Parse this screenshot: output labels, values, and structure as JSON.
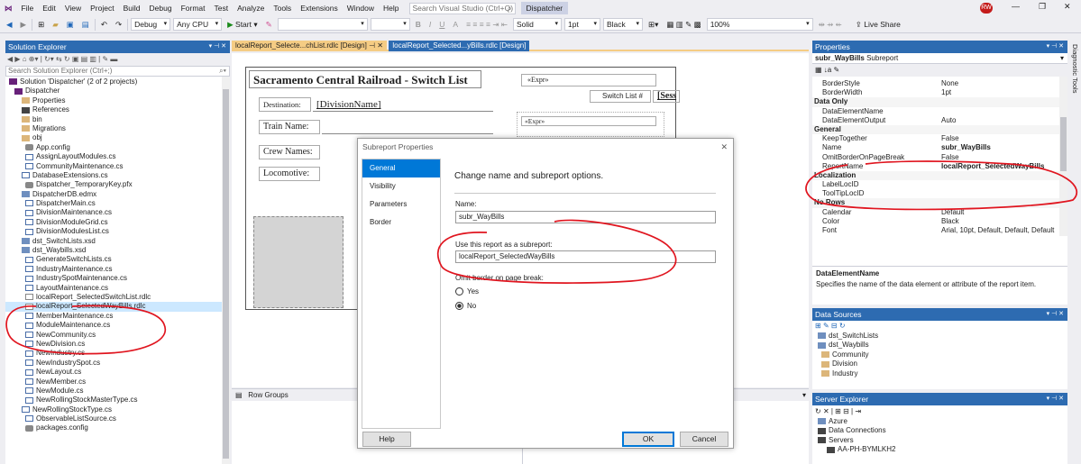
{
  "menu": {
    "items": [
      "File",
      "Edit",
      "View",
      "Project",
      "Build",
      "Debug",
      "Format",
      "Test",
      "Analyze",
      "Tools",
      "Extensions",
      "Window",
      "Help"
    ],
    "search_placeholder": "Search Visual Studio (Ctrl+Q)",
    "solution_name": "Dispatcher",
    "avatar": "RW",
    "live_share": "Live Share"
  },
  "toolbar": {
    "config": "Debug",
    "platform": "Any CPU",
    "start": "Start",
    "border_style": "Solid",
    "border_width": "1pt",
    "border_color": "Black",
    "zoom": "100%"
  },
  "solution_explorer": {
    "title": "Solution Explorer",
    "search_placeholder": "Search Solution Explorer (Ctrl+;)",
    "items": [
      "Solution 'Dispatcher' (2 of 2 projects)",
      "Dispatcher",
      "Properties",
      "References",
      "bin",
      "Migrations",
      "obj",
      "App.config",
      "AssignLayoutModules.cs",
      "CommunityMaintenance.cs",
      "DatabaseExtensions.cs",
      "Dispatcher_TemporaryKey.pfx",
      "DispatcherDB.edmx",
      "DispatcherMain.cs",
      "DivisionMaintenance.cs",
      "DivisionModuleGrid.cs",
      "DivisionModulesList.cs",
      "dst_SwitchLists.xsd",
      "dst_Waybills.xsd",
      "GenerateSwitchLists.cs",
      "IndustryMaintenance.cs",
      "IndustrySpotMaintenance.cs",
      "LayoutMaintenance.cs",
      "localReport_SelectedSwitchList.rdlc",
      "localReport_SelectedWayBills.rdlc",
      "MemberMaintenance.cs",
      "ModuleMaintenance.cs",
      "NewCommunity.cs",
      "NewDivision.cs",
      "NewIndustry.cs",
      "NewIndustrySpot.cs",
      "NewLayout.cs",
      "NewMember.cs",
      "NewModule.cs",
      "NewRollingStockMasterType.cs",
      "NewRollingStockType.cs",
      "ObservableListSource.cs",
      "packages.config"
    ]
  },
  "tabs": {
    "tab1": "localReport_Selecte...chList.rdlc [Design]",
    "tab2": "localReport_Selected...yBills.rdlc [Design]"
  },
  "report": {
    "title": "Sacramento Central Railroad - Switch List",
    "expr1": "«Expr»",
    "switch_list": "Switch List #",
    "sess": "[Sess",
    "destination_label": "Destination:",
    "destination_value": "[DivisionName]",
    "train_name": "Train Name:",
    "crew_names": "Crew Names:",
    "locomotive": "Locomotive:",
    "expr2": "«Expr»",
    "row_groups": "Row Groups"
  },
  "dialog": {
    "title": "Subreport Properties",
    "nav": [
      "General",
      "Visibility",
      "Parameters",
      "Border"
    ],
    "heading": "Change name and subreport options.",
    "name_label": "Name:",
    "name_value": "subr_WayBills",
    "use_label": "Use this report as a subreport:",
    "use_value": "localReport_SelectedWayBills",
    "omit_label": "Omit border on page break:",
    "yes": "Yes",
    "no": "No",
    "help": "Help",
    "ok": "OK",
    "cancel": "Cancel"
  },
  "properties": {
    "title": "Properties",
    "object_name": "subr_WayBills",
    "object_type": "Subreport",
    "rows": [
      {
        "n": "BorderStyle",
        "v": "None",
        "cat": false
      },
      {
        "n": "BorderWidth",
        "v": "1pt",
        "cat": false
      },
      {
        "n": "Data Only",
        "v": "",
        "cat": true
      },
      {
        "n": "DataElementName",
        "v": "",
        "cat": false
      },
      {
        "n": "DataElementOutput",
        "v": "Auto",
        "cat": false
      },
      {
        "n": "General",
        "v": "",
        "cat": true
      },
      {
        "n": "KeepTogether",
        "v": "False",
        "cat": false
      },
      {
        "n": "Name",
        "v": "subr_WayBills",
        "cat": false
      },
      {
        "n": "OmitBorderOnPageBreak",
        "v": "False",
        "cat": false
      },
      {
        "n": "ReportName",
        "v": "localReport_SelectedWayBills",
        "cat": false
      },
      {
        "n": "Localization",
        "v": "",
        "cat": true
      },
      {
        "n": "LabelLocID",
        "v": "",
        "cat": false
      },
      {
        "n": "ToolTipLocID",
        "v": "",
        "cat": false
      },
      {
        "n": "No Rows",
        "v": "",
        "cat": true
      },
      {
        "n": "Calendar",
        "v": "Default",
        "cat": false
      },
      {
        "n": "Color",
        "v": "Black",
        "cat": false
      },
      {
        "n": "Font",
        "v": "Arial, 10pt, Default, Default, Default",
        "cat": false
      }
    ],
    "desc_title": "DataElementName",
    "desc_text": "Specifies the name of the data element or attribute of the report item."
  },
  "data_sources": {
    "title": "Data Sources",
    "items": [
      "dst_SwitchLists",
      "dst_Waybills",
      "Community",
      "Division",
      "Industry"
    ]
  },
  "server_explorer": {
    "title": "Server Explorer",
    "items": [
      "Azure",
      "Data Connections",
      "Servers",
      "AA-PH-BYMLKH2"
    ]
  },
  "side_tabs": "Diagnostic Tools"
}
